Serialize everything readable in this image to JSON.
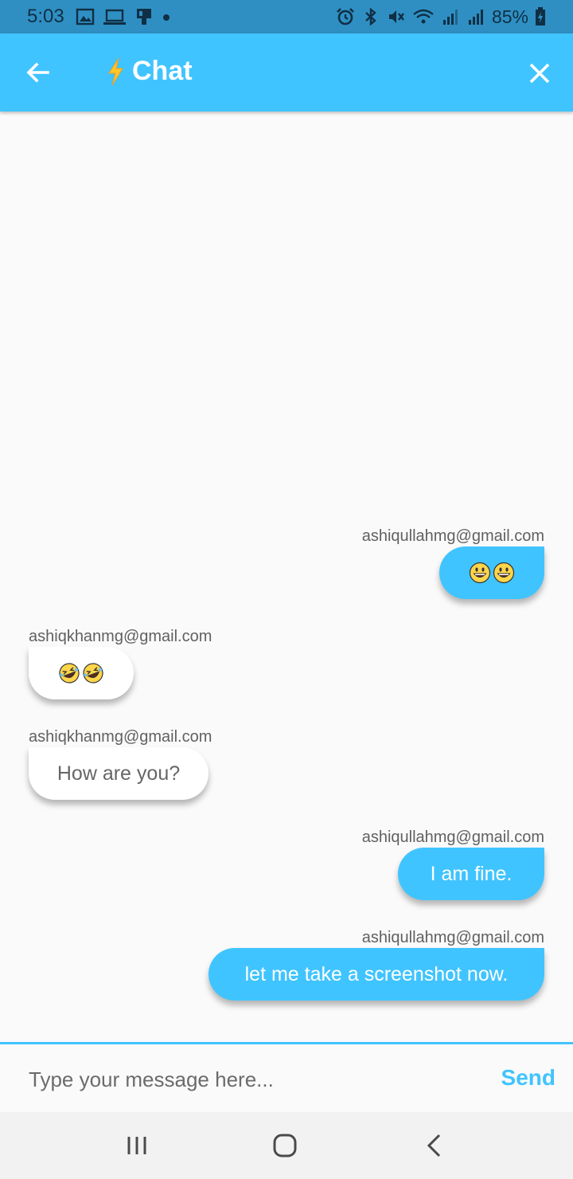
{
  "status_bar": {
    "time": "5:03",
    "battery": "85%",
    "left_icons": [
      "image-icon",
      "laptop-icon",
      "cast-icon",
      "dot-icon"
    ],
    "right_icons": [
      "alarm-icon",
      "bluetooth-icon",
      "mute-icon",
      "wifi-icon",
      "signal-icon",
      "signal-icon",
      "battery-charging-icon"
    ]
  },
  "app_bar": {
    "title": "Chat",
    "title_icon": "lightning-bolt-icon",
    "back_icon": "arrow-left-icon",
    "close_icon": "close-icon",
    "color": "#40c4ff"
  },
  "messages": [
    {
      "sender": "ashiqullahmg@gmail.com",
      "text": "😃😃",
      "mine": true,
      "emoji": [
        "grinning-face-icon",
        "grinning-face-icon"
      ]
    },
    {
      "sender": "ashiqkhanmg@gmail.com",
      "text": "🤣🤣",
      "mine": false,
      "emoji": [
        "rofl-face-icon",
        "rofl-face-icon"
      ]
    },
    {
      "sender": "ashiqkhanmg@gmail.com",
      "text": "How are you?",
      "mine": false
    },
    {
      "sender": "ashiqullahmg@gmail.com",
      "text": "I am fine.",
      "mine": true
    },
    {
      "sender": "ashiqullahmg@gmail.com",
      "text": "let me take a screenshot now.",
      "mine": true
    }
  ],
  "input": {
    "placeholder": "Type your message here...",
    "value": "",
    "send_label": "Send"
  },
  "nav_bar": {
    "icons": [
      "recents-icon",
      "home-icon",
      "back-icon"
    ]
  },
  "colors": {
    "accent": "#40c4ff",
    "status_bar": "#2f8fc3",
    "background": "#fafafa"
  }
}
